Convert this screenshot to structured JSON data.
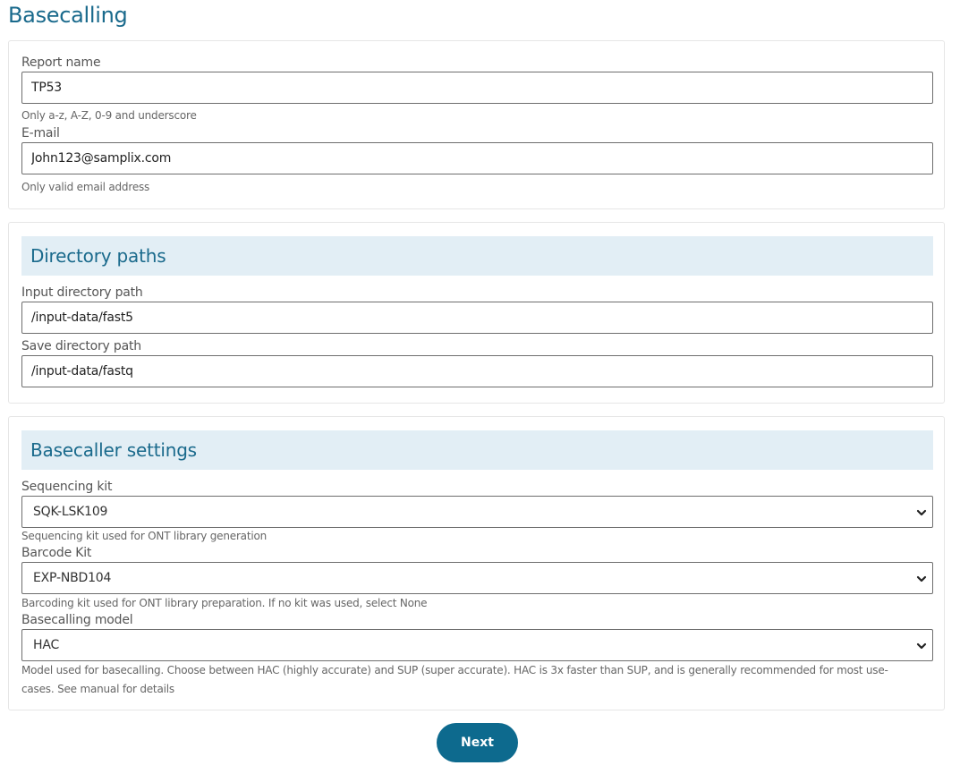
{
  "page": {
    "title": "Basecalling"
  },
  "report": {
    "name_label": "Report name",
    "name_value": "TP53",
    "name_hint": "Only a-z, A-Z, 0-9 and underscore",
    "email_label": "E-mail",
    "email_value": "John123@samplix.com",
    "email_hint": "Only valid email address"
  },
  "directories": {
    "header": "Directory paths",
    "input_label": "Input directory path",
    "input_value": "/input-data/fast5",
    "save_label": "Save directory path",
    "save_value": "/input-data/fastq"
  },
  "basecaller": {
    "header": "Basecaller settings",
    "seq_kit_label": "Sequencing kit",
    "seq_kit_value": "SQK-LSK109",
    "seq_kit_hint": "Sequencing kit used for ONT library generation",
    "barcode_label": "Barcode Kit",
    "barcode_value": "EXP-NBD104",
    "barcode_hint": "Barcoding kit used for ONT library preparation. If no kit was used, select None",
    "model_label": "Basecalling model",
    "model_value": "HAC",
    "model_hint": "Model used for basecalling. Choose between HAC (highly accurate) and SUP (super accurate). HAC is 3x faster than SUP, and is generally recommended for most use-cases. See manual for details"
  },
  "actions": {
    "next_label": "Next"
  },
  "icons": {
    "dropdown": "chevron-down-icon"
  },
  "colors": {
    "accent": "#1a6a8c",
    "button": "#0d6a8e",
    "section_header_bg": "#e2eef5"
  }
}
